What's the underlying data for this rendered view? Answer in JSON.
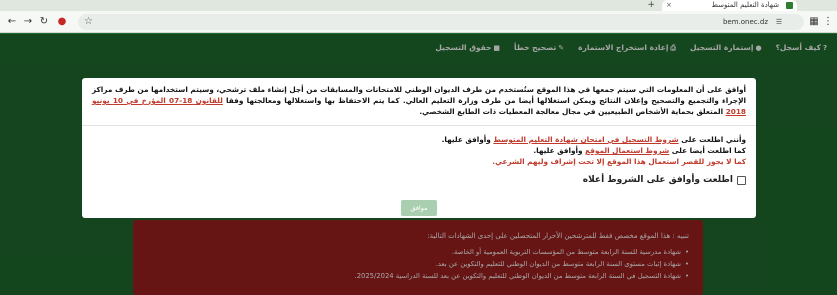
{
  "browser": {
    "tab_title": "شهادة التعليم المتوسط",
    "url": "bem.onec.dz"
  },
  "nav": {
    "items": [
      {
        "label": "كيف أسجل؟",
        "icon": "question-icon"
      },
      {
        "label": "إستمارة التسجيل",
        "icon": "user-icon"
      },
      {
        "label": "إعادة استخراج الاستمارة",
        "icon": "print-icon"
      },
      {
        "label": "تصحيح خطأ",
        "icon": "edit-icon"
      },
      {
        "label": "حقوق التسجيل",
        "icon": "money-icon"
      }
    ]
  },
  "modal": {
    "paragraph_start": "أوافق على أن المعلومات التي سيتم جمعها في هذا الموقع ستُستخدم من طرف الديوان الوطني للامتحانات والمسابقات من أجل إنشاء ملف ترشحي، وسيتم استخدامها من طرف مراكز الإجراء والتجميع والتصحيح وإعلان النتائج ويمكن استغلالها أيضا من طرف وزارة التعليم العالي. كما يتم الاحتفاظ بها واستغلالها ومعالجتها وفقا ",
    "law_link": "للقانون 18-07 المؤرخ في 10 يونيو 2018",
    "paragraph_end": " المتعلق بحماية الأشخاص الطبيعيين في مجال معالجة المعطيات ذات الطابع الشخصي.",
    "line1_pre": "وأنني اطلعت على ",
    "line1_link": "شروط التسجيل في امتحان شهادة التعليم المتوسط",
    "line1_post": " وأوافق عليها.",
    "line2_pre": "كما اطلعت أيضا على ",
    "line2_link": "شروط استعمال الموقع",
    "line2_post": " وأوافق عليها.",
    "warning": "كما لا يجوز للقصر استعمال هذا الموقع إلا تحت إشراف وليهم الشرعي.",
    "agree_label": "اطلعت وأوافق على الشروط أعلاه",
    "confirm_label": "موافق"
  },
  "notice": {
    "title": "تنبيه : هذا الموقع مخصص فقط للمترشحين الأحرار المتحصلين على إحدى الشهادات التالية:",
    "items": [
      "شهادة مدرسية للسنة الرابعة متوسط من المؤسسات التربوية العمومية أو الخاصة.",
      "شهادة إثبات مستوى السنة الرابعة متوسط من الديوان الوطني للتعليم والتكوين عن بعد.",
      "شهادة التسجيل في السنة الرابعة متوسط من الديوان الوطني للتعليم والتكوين عن بعد للسنة الدراسية 2025/2024."
    ]
  },
  "colors": {
    "brand_green": "#1f6b2e",
    "notice_red": "#9e1f1f",
    "link_red": "#c0392b"
  }
}
